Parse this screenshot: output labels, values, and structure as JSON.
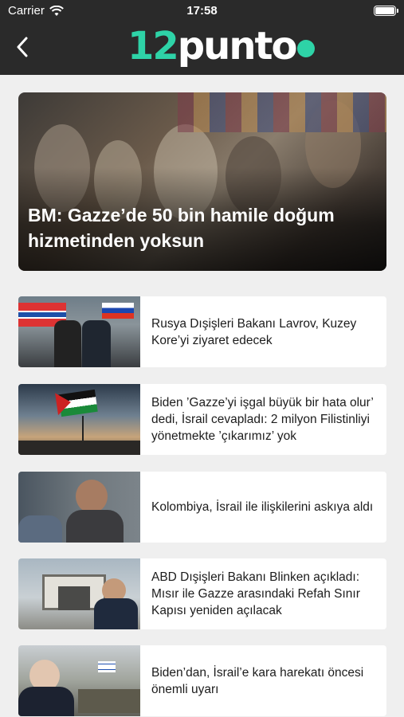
{
  "status_bar": {
    "carrier": "Carrier",
    "time": "17:58"
  },
  "header": {
    "logo_number": "12",
    "logo_word": "punto"
  },
  "featured": {
    "title": "BM: Gazze’de 50 bin hamile doğum hizmetinden yoksun"
  },
  "articles": [
    {
      "title": "Rusya Dışişleri Bakanı Lavrov, Kuzey Kore’yi ziyaret edecek"
    },
    {
      "title": "Biden ’Gazze’yi işgal büyük bir hata olur’ dedi, İsrail cevapladı: 2 milyon Filistinliyi yönetmekte ’çıkarımız’ yok"
    },
    {
      "title": "Kolombiya, İsrail ile ilişkilerini askıya aldı"
    },
    {
      "title": "ABD Dışişleri Bakanı Blinken açıkladı: Mısır ile Gazze arasındaki Refah Sınır Kapısı yeniden açılacak"
    },
    {
      "title": "Biden’dan, İsrail’e kara harekatı öncesi önemli uyarı"
    }
  ],
  "colors": {
    "header_bg": "#2a2a2a",
    "accent": "#2ed3a7",
    "page_bg": "#efefef"
  }
}
